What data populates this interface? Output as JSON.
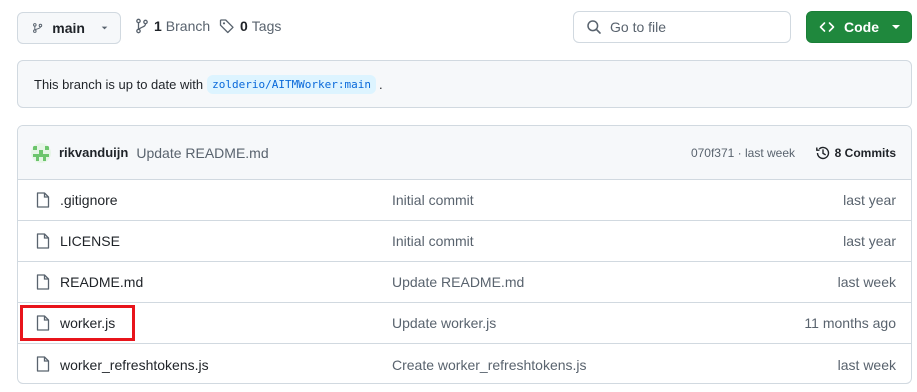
{
  "toolbar": {
    "branch_name": "main",
    "branch_count": "1",
    "branch_label": "Branch",
    "tag_count": "0",
    "tag_label": "Tags",
    "search_placeholder": "Go to file",
    "code_label": "Code"
  },
  "notice": {
    "prefix": "This branch is up to date with",
    "ref": "zolderio/AITMWorker:main",
    "suffix": "."
  },
  "latest_commit": {
    "author": "rikvanduijn",
    "message": "Update README.md",
    "hash_time": "070f371 · last week",
    "commits_label": "8 Commits"
  },
  "files": [
    {
      "name": ".gitignore",
      "commit": "Initial commit",
      "date": "last year"
    },
    {
      "name": "LICENSE",
      "commit": "Initial commit",
      "date": "last year"
    },
    {
      "name": "README.md",
      "commit": "Update README.md",
      "date": "last week"
    },
    {
      "name": "worker.js",
      "commit": "Update worker.js",
      "date": "11 months ago"
    },
    {
      "name": "worker_refreshtokens.js",
      "commit": "Create worker_refreshtokens.js",
      "date": "last week"
    }
  ],
  "colors": {
    "code_button": "#1f883d",
    "highlight_box": "#e8141b",
    "ref_background": "#ddf4ff",
    "ref_text": "#0969da"
  }
}
